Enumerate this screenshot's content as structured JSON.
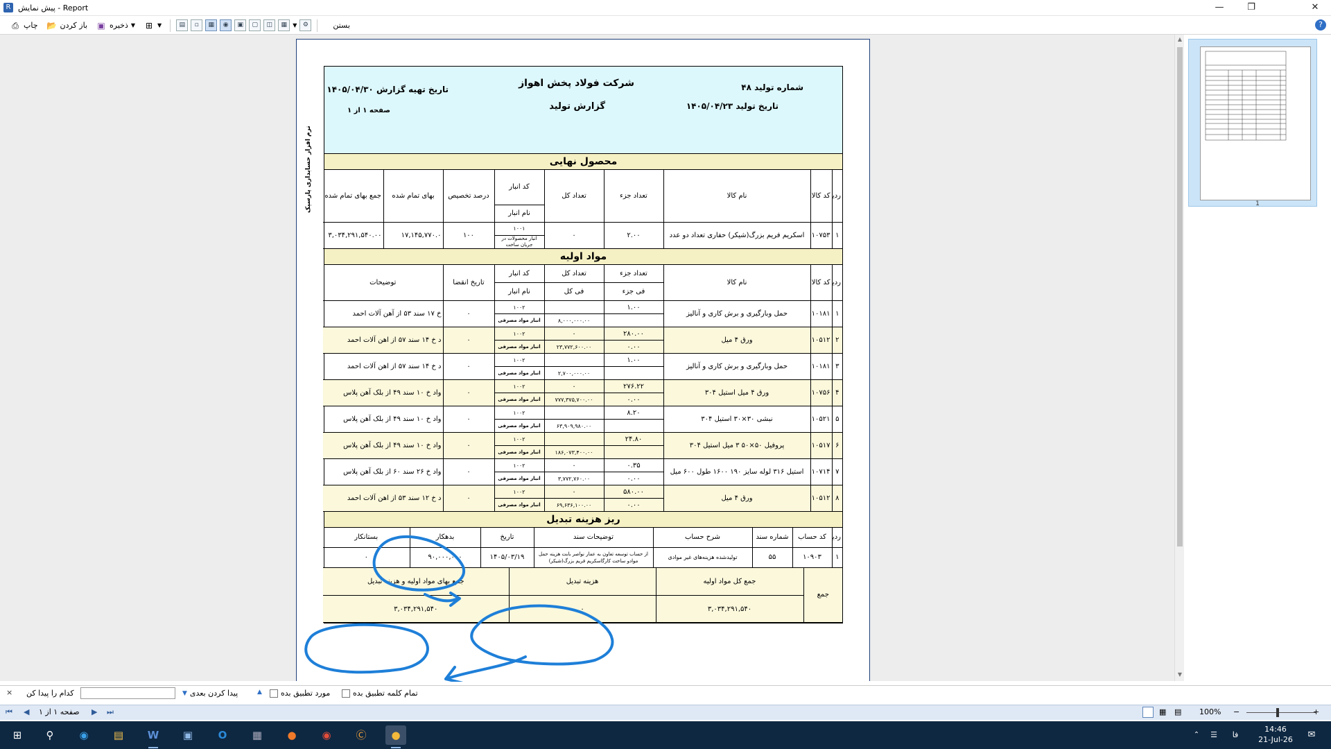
{
  "window": {
    "title": "پیش نمایش - Report",
    "icon": "report-app-icon"
  },
  "toolbar": {
    "print": "چاپ",
    "open": "باز کردن",
    "save": "ذخیره",
    "close": "بستن"
  },
  "report": {
    "company": "شرکت فولاد پخش اهواز",
    "subtitle": "گزارش تولید",
    "prod_no_label": "شماره تولید",
    "prod_no": "۴۸",
    "prod_date_label": "تاریخ تولید",
    "prod_date": "۱۴۰۵/۰۴/۲۳",
    "report_date_label": "تاریخ تهیه گزارش",
    "report_date": "۱۴۰۵/۰۴/۳۰",
    "page_label": "صفحه ۱ از ۱",
    "side_label": "نرم افزار حسابداری پارسیک",
    "final": {
      "title": "محصول نهایی",
      "headers": {
        "row": "ردیف",
        "code": "کد کالا",
        "name": "نام کالا",
        "unit_qty": "تعداد جزء",
        "total_qty": "تعداد کل",
        "store_code": "کد انبار",
        "store_name": "نام انبار",
        "alloc": "درصد تخصیص",
        "price": "بهای تمام شده",
        "total_price": "جمع بهای تمام شده"
      },
      "row": {
        "row": "۱",
        "code": "۱۰۷۵۳",
        "name": "اسکریم فریم بزرگ(شیکر) حفاری  تعداد دو عدد",
        "unit_qty": "۲.۰۰",
        "total_qty": "۰",
        "store_code": "۱۰۰۱",
        "store_name": "انبار محصولات در جریان ساخت",
        "alloc": "۱۰۰",
        "price": "۱۷,۱۴۵,۷۷۰.۰",
        "total_price": "۳,۰۳۴,۲۹۱,۵۴۰.۰۰"
      }
    },
    "materials": {
      "title": "مواد اولیه",
      "headers": {
        "row": "ردیف",
        "code": "کد کالا",
        "name": "نام کالا",
        "unit_qty": "تعداد جزء",
        "unit_fee": "فی جزء",
        "total_qty": "تعداد کل",
        "total_fee": "فی کل",
        "store_code": "کد انبار",
        "store_name": "نام انبار",
        "expiry": "تاریخ انقضا",
        "desc": "توضیحات"
      },
      "rows": [
        {
          "row": "۱",
          "code": "۱۰۱۸۱",
          "name": "حمل وبارگیری و برش کاری و آنالیز",
          "unit_qty": "۱.۰۰",
          "unit_fee": "",
          "total_qty": "",
          "total_fee": "۸,۰۰۰,۰۰۰.۰۰",
          "store_code": "۱۰۰۲",
          "store_name": "انبار مواد مصرفی",
          "expiry": "۰",
          "desc": "خ ۱۷ سند ۵۳ از آهن آلات احمد",
          "y": false
        },
        {
          "row": "۲",
          "code": "۱۰۵۱۲",
          "name": "ورق ۴ میل",
          "unit_qty": "۲۸۰.۰۰",
          "unit_fee": "۰.۰۰",
          "total_qty": "۰",
          "total_fee": "۲۳,۷۷۲,۶۰۰.۰۰",
          "store_code": "۱۰۰۲",
          "store_name": "انبار مواد مصرفی",
          "expiry": "۰",
          "desc": "د خ ۱۴ سند ۵۷ از اهن آلات احمد",
          "y": true
        },
        {
          "row": "۳",
          "code": "۱۰۱۸۱",
          "name": "حمل وبارگیری و برش کاری و آنالیز",
          "unit_qty": "۱.۰۰",
          "unit_fee": "",
          "total_qty": "",
          "total_fee": "۲,۷۰۰,۰۰۰.۰۰",
          "store_code": "۱۰۰۲",
          "store_name": "انبار مواد مصرفی",
          "expiry": "۰",
          "desc": "د خ ۱۴ سند ۵۷ از اهن آلات احمد",
          "y": false
        },
        {
          "row": "۴",
          "code": "۱۰۷۵۶",
          "name": "ورق ۴ میل استیل ۳۰۴",
          "unit_qty": "۲۷۶.۲۲",
          "unit_fee": "۰.۰۰",
          "total_qty": "۰",
          "total_fee": "۷۷۷,۳۷۵,۷۰۰.۰۰",
          "store_code": "۱۰۰۲",
          "store_name": "انبار مواد مصرفی",
          "expiry": "۰",
          "desc": "واد خ ۱۰ سند ۴۹ از بلک آهن پلاس",
          "y": true
        },
        {
          "row": "۵",
          "code": "۱۰۵۲۱",
          "name": "نبشی ۳۰×۳۰ استیل ۳۰۴",
          "unit_qty": "۸.۲۰",
          "unit_fee": "",
          "total_qty": "",
          "total_fee": "۶۳,۹۰۹,۹۸۰.۰۰",
          "store_code": "۱۰۰۲",
          "store_name": "انبار مواد مصرفی",
          "expiry": "۰",
          "desc": "واد خ ۱۰ سند ۴۹ از بلک آهن پلاس",
          "y": false
        },
        {
          "row": "۶",
          "code": "۱۰۵۱۷",
          "name": "پروفیل ۵۰×۵۰ ۳ میل استیل ۳۰۴",
          "unit_qty": "۲۴.۸۰",
          "unit_fee": "",
          "total_qty": "",
          "total_fee": "۱۸۶,۰۷۳,۴۰۰.۰۰",
          "store_code": "۱۰۰۲",
          "store_name": "انبار مواد مصرفی",
          "expiry": "۰",
          "desc": "واد خ ۱۰ سند ۴۹ از بلک آهن پلاس",
          "y": true
        },
        {
          "row": "۷",
          "code": "۱۰۷۱۴",
          "name": "استیل ۳۱۶ لوله سایز ۱۹۰ ۱۶۰۰ طول ۶۰۰ میل",
          "unit_qty": "۰.۳۵",
          "unit_fee": "۰.۰۰",
          "total_qty": "۰",
          "total_fee": "۳,۷۷۲,۷۶۰.۰۰",
          "store_code": "۱۰۰۲",
          "store_name": "انبار مواد مصرفی",
          "expiry": "۰",
          "desc": "واد خ ۲۶ سند ۶۰ از بلک آهن پلاس",
          "y": false
        },
        {
          "row": "۸",
          "code": "۱۰۵۱۲",
          "name": "ورق ۴ میل",
          "unit_qty": "۵۸۰.۰۰",
          "unit_fee": "۰.۰۰",
          "total_qty": "۰",
          "total_fee": "۶۹,۶۳۶,۱۰۰.۰۰",
          "store_code": "۱۰۰۲",
          "store_name": "انبار مواد مصرفی",
          "expiry": "۰",
          "desc": "د خ ۱۲ سند ۵۳ از اهن آلات احمد",
          "y": true
        }
      ]
    },
    "conversion": {
      "title": "ریز هزینه تبدیل",
      "headers": {
        "row": "ردیف",
        "acc_code": "کد حساب",
        "doc_no": "شماره سند",
        "acc_desc": "شرح حساب",
        "doc_desc": "توضیحات سند",
        "date": "تاریخ",
        "debit": "بدهکار",
        "credit": "بستانکار"
      },
      "row": {
        "row": "۱",
        "acc_code": "۱۰۹۰۳",
        "doc_no": "۵۵",
        "acc_desc": "تولیدشده هزینه‌های غیر موادی",
        "doc_desc": "از حساب توسعه تعاون به عمار نواصر بابت هزینه حمل موادو ساخت کارگاسکریم فریم بزرگ(شیکر)",
        "date": "۱۴۰۵/۰۳/۱۹",
        "debit": "۹۰,۰۰۰,۰۰۰",
        "credit": "۰"
      }
    },
    "totals": {
      "sum_label": "جمع",
      "materials_total_label": "جمع کل مواد اولیه",
      "materials_total": "۳,۰۳۴,۲۹۱,۵۴۰",
      "conversion_label": "هزینه تبدیل",
      "conversion_value": "۰",
      "grand_label": "جمع بهای مواد اولیه و هزینه تبدیل",
      "grand_value": "۳,۰۳۴,۲۹۱,۵۴۰"
    }
  },
  "findbar": {
    "close": "×",
    "label": "کدام را پیدا کن",
    "find_next": "پیدا کردن بعدی",
    "match_case": "مورد تطبیق بده",
    "whole_word": "تمام کلمه تطبیق بده",
    "query": ""
  },
  "statusbar": {
    "page": "صفحه ۱ از ۱",
    "zoom": "100%"
  },
  "thumbnail": {
    "page_no": "1"
  },
  "taskbar": {
    "time": "14:46",
    "date": "21-Jul-26",
    "lang": "فا"
  },
  "colors": {
    "header_bg": "#ddf8fc",
    "section_bg": "#f6f1c4",
    "row_yellow": "#fbf8dc",
    "annotation": "#1e7fd8",
    "taskbar": "#0e2842"
  }
}
